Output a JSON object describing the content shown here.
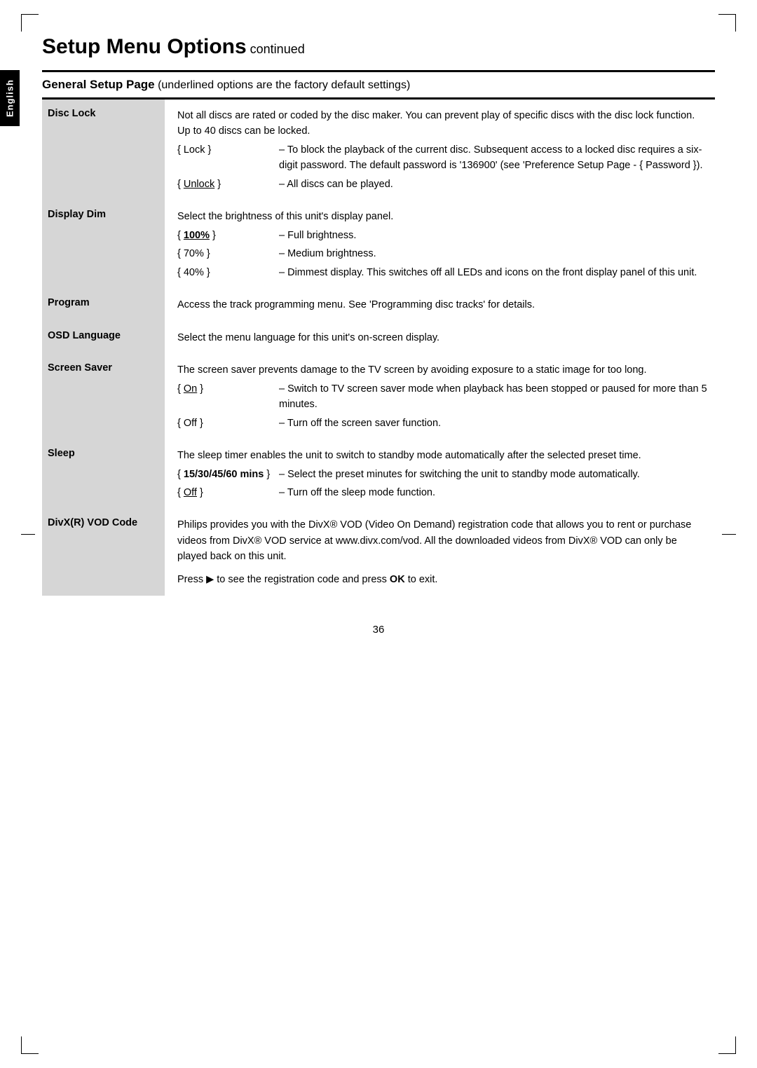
{
  "page": {
    "title": "Setup Menu Options",
    "title_suffix": " continued",
    "page_number": "36"
  },
  "header": {
    "section_title": "General Setup Page",
    "section_subtitle": " (underlined options are the factory default settings)",
    "tab_label": "English"
  },
  "rows": [
    {
      "label": "Disc Lock",
      "intro": "Not all discs are rated or coded by the disc maker. You can prevent play of specific discs with the disc lock function. Up to 40 discs can be locked.",
      "options": [
        {
          "key": "{ Lock }",
          "key_style": "normal",
          "desc": "– To block the playback of the current disc. Subsequent access to a locked disc requires a six-digit password.  The default password is '136900' (see 'Preference Setup Page - { Password })."
        },
        {
          "key": "{ Unlock }",
          "key_style": "underline",
          "desc": "– All discs can be played."
        }
      ]
    },
    {
      "label": "Display Dim",
      "intro": "Select the brightness of this unit's display panel.",
      "options": [
        {
          "key": "{ 100% }",
          "key_style": "bold-underline",
          "desc": "– Full brightness."
        },
        {
          "key": "{ 70% }",
          "key_style": "normal",
          "desc": "– Medium brightness."
        },
        {
          "key": "{ 40% }",
          "key_style": "normal",
          "desc": "– Dimmest display.  This switches off all LEDs and icons on the front display panel of this unit."
        }
      ]
    },
    {
      "label": "Program",
      "intro": "Access the track programming menu.  See 'Programming disc tracks' for details.",
      "options": []
    },
    {
      "label": "OSD Language",
      "intro": "Select the menu language for this unit's on-screen display.",
      "options": []
    },
    {
      "label": "Screen Saver",
      "intro": "The screen saver prevents damage to the TV screen by avoiding exposure to a static image for too long.",
      "options": [
        {
          "key": "{ On }",
          "key_style": "underline",
          "desc": "– Switch to TV screen saver mode when playback has been stopped or paused for more than 5 minutes."
        },
        {
          "key": "{ Off }",
          "key_style": "normal",
          "desc": "– Turn off the screen saver function."
        }
      ]
    },
    {
      "label": "Sleep",
      "intro": "The sleep timer enables the unit to switch to standby mode automatically after the selected preset time.",
      "options": [
        {
          "key": "{ 15/30/45/60 mins }",
          "key_style": "bold",
          "desc": "– Select the preset minutes for switching the unit to standby mode automatically."
        },
        {
          "key": "{ Off }",
          "key_style": "underline",
          "desc": "– Turn off the sleep mode function."
        }
      ]
    },
    {
      "label": "DivX(R) VOD Code",
      "intro": "Philips provides you with the DivX® VOD (Video On Demand) registration code that allows you to rent or purchase videos from DivX® VOD service at www.divx.com/vod.  All the downloaded videos from DivX® VOD can only be played back on this unit.",
      "options": [],
      "extra": "Press ▶ to see the registration code and press OK to exit."
    }
  ]
}
